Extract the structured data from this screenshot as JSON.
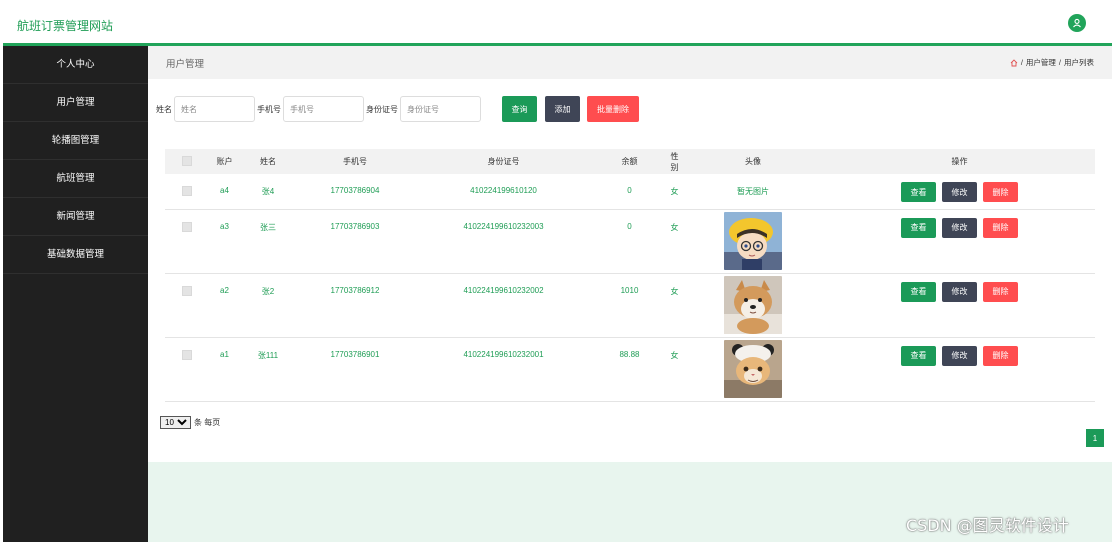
{
  "header": {
    "site_title": "航班订票管理网站"
  },
  "sidebar": {
    "items": [
      {
        "label": "个人中心"
      },
      {
        "label": "用户管理"
      },
      {
        "label": "轮播图管理"
      },
      {
        "label": "航班管理"
      },
      {
        "label": "新闻管理"
      },
      {
        "label": "基础数据管理"
      }
    ]
  },
  "page": {
    "title": "用户管理",
    "breadcrumb": [
      "用户管理",
      "用户列表"
    ],
    "breadcrumb_sep": "/"
  },
  "search": {
    "name_label": "姓名",
    "name_placeholder": "姓名",
    "phone_label": "手机号",
    "phone_placeholder": "手机号",
    "id_label": "身份证号",
    "id_placeholder": "身份证号",
    "query_button": "查询",
    "add_button": "添加",
    "bulk_delete_button": "批量删除"
  },
  "table": {
    "columns": [
      "账户",
      "姓名",
      "手机号",
      "身份证号",
      "余额",
      "性别",
      "头像",
      "操作"
    ],
    "rows": [
      {
        "account": "a4",
        "name": "张4",
        "phone": "17703786904",
        "id_no": "410224199610120",
        "balance": "0",
        "gender": "女",
        "avatar_text": "暂无图片",
        "avatar": "none"
      },
      {
        "account": "a3",
        "name": "张三",
        "phone": "17703786903",
        "id_no": "410224199610232003",
        "balance": "0",
        "gender": "女",
        "avatar_text": "",
        "avatar": "cartoon"
      },
      {
        "account": "a2",
        "name": "张2",
        "phone": "17703786912",
        "id_no": "410224199610232002",
        "balance": "1010",
        "gender": "女",
        "avatar_text": "",
        "avatar": "dog"
      },
      {
        "account": "a1",
        "name": "张111",
        "phone": "17703786901",
        "id_no": "410224199610232001",
        "balance": "88.88",
        "gender": "女",
        "avatar_text": "",
        "avatar": "cat"
      }
    ],
    "actions": {
      "view": "查看",
      "edit": "修改",
      "delete": "删除"
    }
  },
  "pagination": {
    "page_size": "10",
    "page_size_suffix": "条 每页",
    "current_page": "1"
  },
  "watermark": "CSDN @图灵软件设计",
  "colors": {
    "primary": "#1b9a58",
    "dark": "#3f4556",
    "danger": "#ff4d4f",
    "sidebar": "#202020"
  }
}
